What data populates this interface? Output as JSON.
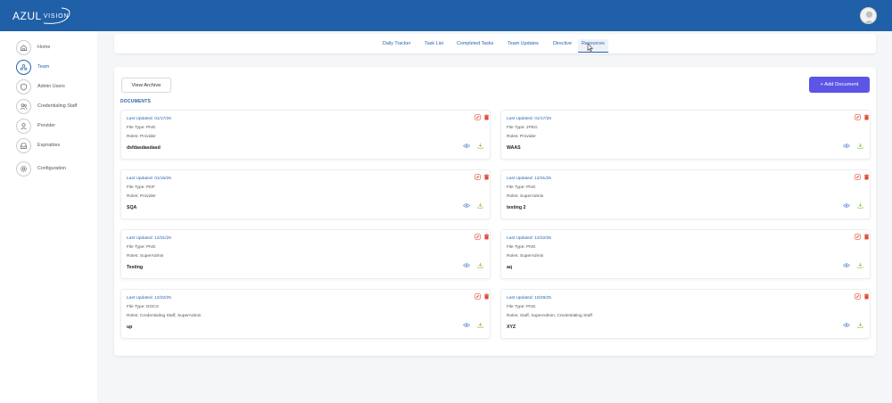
{
  "header": {
    "logo_main": "AZUL",
    "logo_sub": "VISION"
  },
  "sidebar": {
    "items": [
      {
        "label": "Home",
        "icon": "home-icon",
        "active": false
      },
      {
        "label": "Team",
        "icon": "team-icon",
        "active": true
      },
      {
        "label": "Admin Users",
        "icon": "shield-icon",
        "active": false
      },
      {
        "label": "Credentialing Staff",
        "icon": "users-icon",
        "active": false
      },
      {
        "label": "Provider",
        "icon": "user-icon",
        "active": false
      },
      {
        "label": "Expirables",
        "icon": "inbox-icon",
        "active": false
      },
      {
        "label": "Configuration",
        "icon": "gear-icon",
        "active": false
      }
    ]
  },
  "tabs": [
    {
      "label": "Daily Tracker"
    },
    {
      "label": "Task List"
    },
    {
      "label": "Completed Tasks"
    },
    {
      "label": "Team Updates"
    },
    {
      "label": "Directive"
    },
    {
      "label": "Resources",
      "active": true
    }
  ],
  "toolbar": {
    "archive_label": "View Archive",
    "add_label": "+ Add Document"
  },
  "section_label": "DOCUMENTS",
  "documents": [
    {
      "updated": "Last Updated: 01/17/26",
      "file_type": "File Type: PNG",
      "roles": "Roles: Provider",
      "name": "dsfdasdasdasd"
    },
    {
      "updated": "Last Updated: 01/17/26",
      "file_type": "File Type: JPEG",
      "roles": "Roles: Provider",
      "name": "WAAS"
    },
    {
      "updated": "Last Updated: 01/15/26",
      "file_type": "File Type: PDF",
      "roles": "Roles: Provider",
      "name": "SQA"
    },
    {
      "updated": "Last Updated: 12/31/25",
      "file_type": "File Type: PNG",
      "roles": "Roles: SuperAdmin",
      "name": "testing 2"
    },
    {
      "updated": "Last Updated: 12/31/25",
      "file_type": "File Type: PNG",
      "roles": "Roles: SuperAdmin",
      "name": "Testing"
    },
    {
      "updated": "Last Updated: 12/22/25",
      "file_type": "File Type: PNG",
      "roles": "Roles: SuperAdmin",
      "name": "aq"
    },
    {
      "updated": "Last Updated: 12/22/25",
      "file_type": "File Type: DOCX",
      "roles": "Roles: Credentialing Staff, SuperAdmin",
      "name": "up"
    },
    {
      "updated": "Last Updated: 10/29/25",
      "file_type": "File Type: PNG",
      "roles": "Roles: Staff, SuperAdmin, Credentialing Staff",
      "name": "XYZ"
    }
  ],
  "colors": {
    "header_bg": "#2060a8",
    "accent": "#2a64b0",
    "add_button": "#5c55e6",
    "delete": "#e04a3a",
    "edit": "#e8553f",
    "view": "#6c8fd8",
    "download": "#8cc24a"
  }
}
